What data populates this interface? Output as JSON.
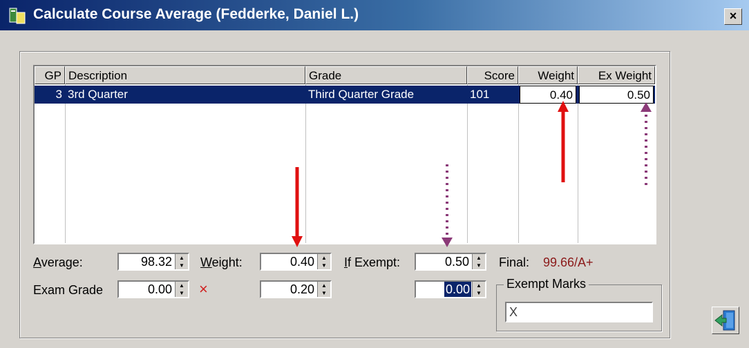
{
  "window": {
    "title": "Calculate Course Average (Fedderke, Daniel L.)",
    "close_label": "×"
  },
  "grid": {
    "headers": [
      "GP",
      "Description",
      "Grade",
      "Score",
      "Weight",
      "Ex Weight"
    ],
    "rows": [
      {
        "gp": "3",
        "description": "3rd Quarter",
        "grade": "Third Quarter Grade",
        "score": "101",
        "weight": "0.40",
        "ex_weight": "0.50"
      }
    ]
  },
  "form": {
    "average_label": "Average:",
    "average_value": "98.32",
    "weight_label": "Weight:",
    "weight_value": "0.40",
    "if_exempt_label": "If Exempt:",
    "if_exempt_value": "0.50",
    "final_label": "Final:",
    "final_value": "99.66/A+",
    "exam_grade_label": "Exam Grade",
    "exam_grade_value": "0.00",
    "x_mark": "×",
    "exam_weight_value": "0.20",
    "exam_exempt_weight_value": "0.00",
    "exempt_marks_label": "Exempt Marks",
    "exempt_marks_value": "X"
  },
  "colors": {
    "selection": "#0a246a",
    "arrow_solid": "#e01010",
    "arrow_dotted": "#8b3a78",
    "final_text": "#8b1a1a"
  },
  "icons": [
    "app-icon",
    "close-icon",
    "exit-door-icon",
    "spinner-up-icon",
    "spinner-down-icon"
  ]
}
